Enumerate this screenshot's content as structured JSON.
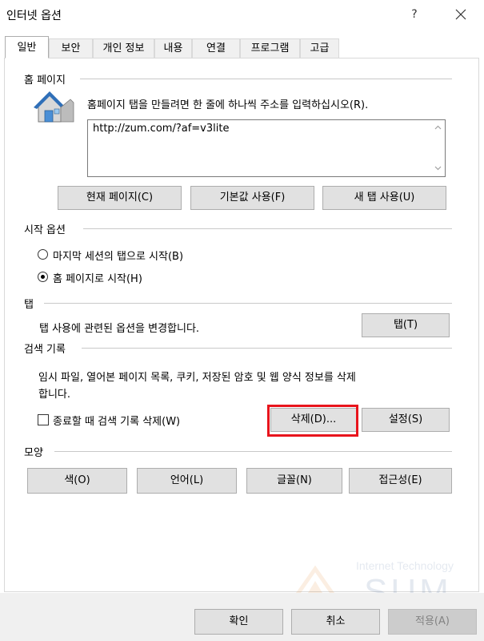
{
  "window": {
    "title": "인터넷 옵션",
    "help": "?"
  },
  "tabs": [
    {
      "label": "일반",
      "active": true
    },
    {
      "label": "보안"
    },
    {
      "label": "개인 정보"
    },
    {
      "label": "내용"
    },
    {
      "label": "연결"
    },
    {
      "label": "프로그램"
    },
    {
      "label": "고급"
    }
  ],
  "homepage": {
    "header": "홈 페이지",
    "description": "홈페이지 탭을 만들려면 한 줄에 하나씩 주소를 입력하십시오(R).",
    "url": "http://zum.com/?af=v3lite",
    "btn_current": "현재 페이지(C)",
    "btn_default": "기본값 사용(F)",
    "btn_newtab": "새 탭 사용(U)"
  },
  "startup": {
    "header": "시작 옵션",
    "option_last_session": "마지막 세션의 탭으로 시작(B)",
    "option_homepage": "홈 페이지로 시작(H)",
    "selected": "homepage"
  },
  "tabs_group": {
    "header": "탭",
    "description": "탭 사용에 관련된 옵션을 변경합니다.",
    "btn_tabs": "탭(T)"
  },
  "history": {
    "header": "검색 기록",
    "description_line1": "임시 파일, 열어본 페이지 목록, 쿠키, 저장된 암호 및 웹 양식 정보를 삭제",
    "description_line2": "합니다.",
    "checkbox_label": "종료할 때 검색 기록 삭제(W)",
    "checkbox_checked": false,
    "btn_delete": "삭제(D)...",
    "btn_settings": "설정(S)"
  },
  "appearance": {
    "header": "모양",
    "btn_colors": "색(O)",
    "btn_languages": "언어(L)",
    "btn_fonts": "글꼴(N)",
    "btn_accessibility": "접근성(E)"
  },
  "watermark": {
    "line1": "Internet Technology",
    "line2": "SUM"
  },
  "footer": {
    "btn_ok": "확인",
    "btn_cancel": "취소",
    "btn_apply": "적용(A)"
  },
  "colors": {
    "highlight": "#e8141c",
    "button_face": "#e1e1e1",
    "disabled_text": "#838383"
  }
}
